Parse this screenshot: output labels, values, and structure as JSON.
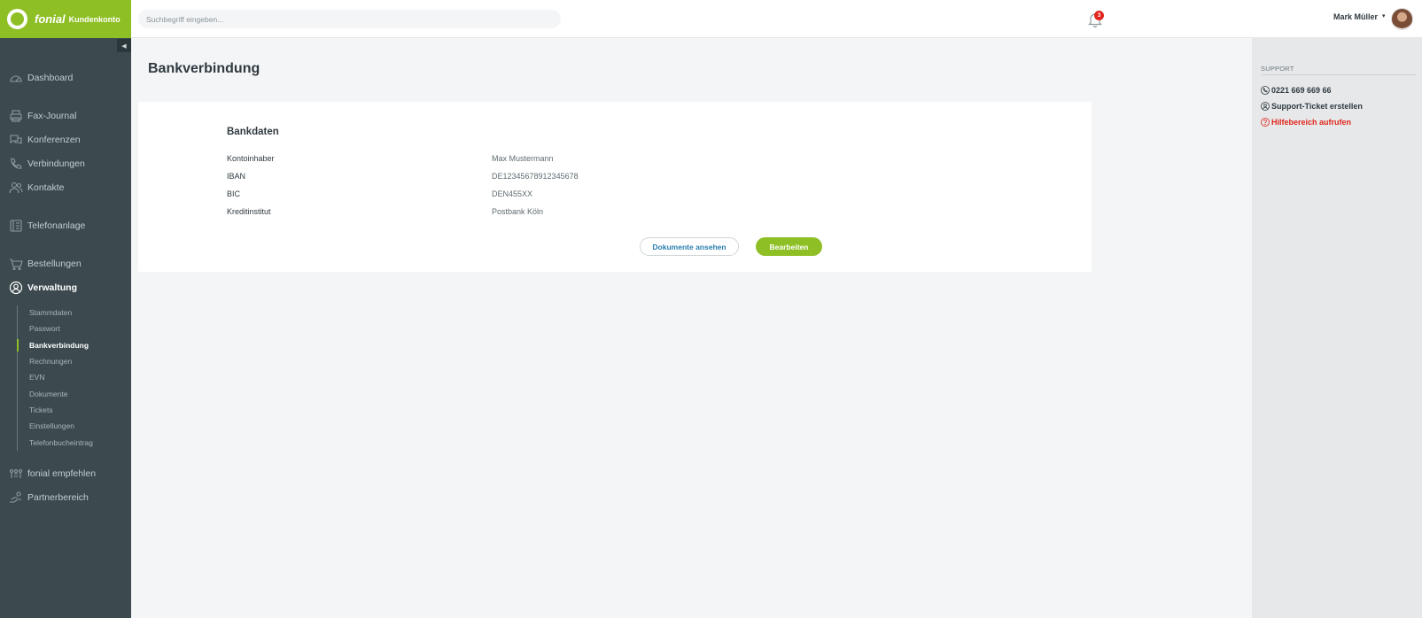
{
  "brand": {
    "name": "fonial",
    "sub": "Kundenkonto"
  },
  "colors": {
    "accent": "#8ebf24",
    "sidebar": "#3c4a4f",
    "link": "#2a7fae",
    "alert": "#e2261c"
  },
  "sidebar": {
    "collapse_glyph": "◀",
    "items": [
      {
        "label": "Dashboard",
        "icon": "gauge-icon"
      },
      {
        "label": "Fax-Journal",
        "icon": "printer-icon"
      },
      {
        "label": "Konferenzen",
        "icon": "chat-icon"
      },
      {
        "label": "Verbindungen",
        "icon": "phone-icon"
      },
      {
        "label": "Kontakte",
        "icon": "people-icon"
      },
      {
        "label": "Telefonanlage",
        "icon": "pbx-icon"
      },
      {
        "label": "Bestellungen",
        "icon": "cart-icon"
      },
      {
        "label": "Verwaltung",
        "icon": "user-circle-icon",
        "active": true
      },
      {
        "label": "fonial empfehlen",
        "icon": "recommend-icon"
      },
      {
        "label": "Partnerbereich",
        "icon": "partner-icon"
      }
    ],
    "subitems": [
      {
        "label": "Stammdaten"
      },
      {
        "label": "Passwort"
      },
      {
        "label": "Bankverbindung",
        "active": true
      },
      {
        "label": "Rechnungen"
      },
      {
        "label": "EVN"
      },
      {
        "label": "Dokumente"
      },
      {
        "label": "Tickets"
      },
      {
        "label": "Einstellungen"
      },
      {
        "label": "Telefonbucheintrag"
      }
    ]
  },
  "header": {
    "search_placeholder": "Suchbegriff eingeben...",
    "notification_count": "3",
    "user_name": "Mark Müller",
    "user_caret": "▾"
  },
  "main": {
    "title": "Bankverbindung",
    "section_title": "Bankdaten",
    "rows": [
      {
        "label": "Kontoinhaber",
        "value": "Max Mustermann"
      },
      {
        "label": "IBAN",
        "value": "DE12345678912345678"
      },
      {
        "label": "BIC",
        "value": "DEN455XX"
      },
      {
        "label": "Kreditinstitut",
        "value": "Postbank Köln"
      }
    ],
    "btn_documents": "Dokumente ansehen",
    "btn_edit": "Bearbeiten"
  },
  "support": {
    "title": "SUPPORT",
    "phone": "0221 669 669 66",
    "ticket": "Support-Ticket erstellen",
    "help": "Hilfebereich aufrufen"
  }
}
